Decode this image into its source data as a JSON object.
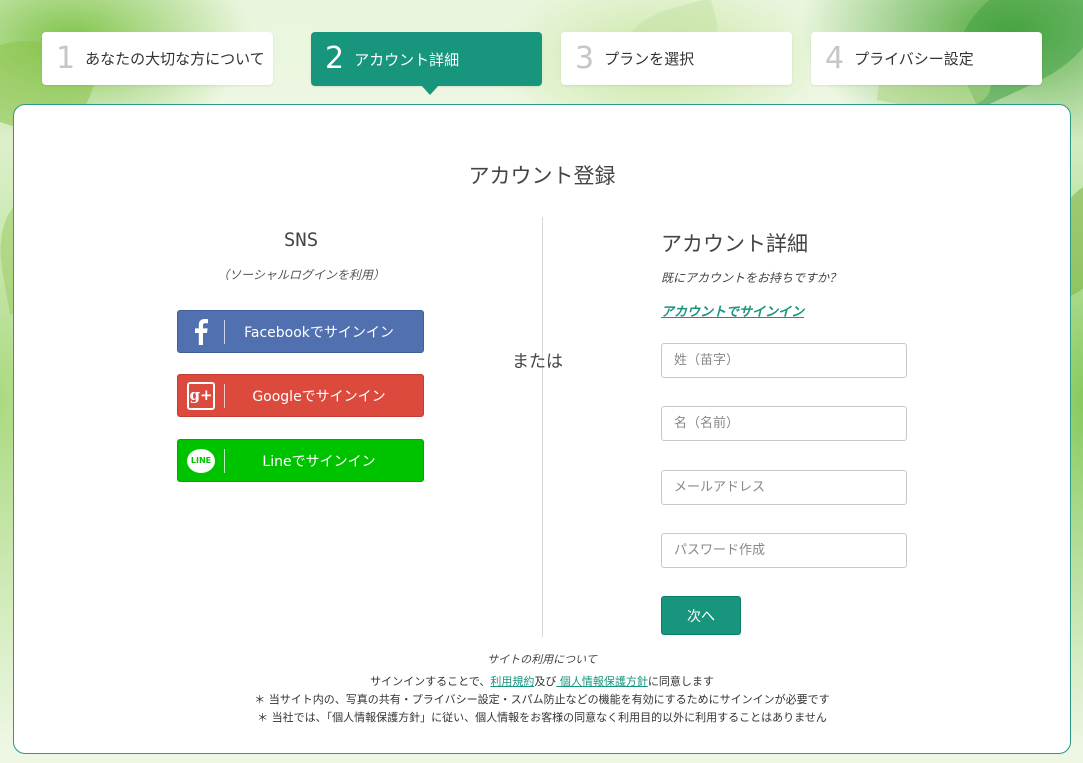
{
  "steps": [
    {
      "num": "1",
      "label": "あなたの大切な方について"
    },
    {
      "num": "2",
      "label": "アカウント詳細"
    },
    {
      "num": "3",
      "label": "プランを選択"
    },
    {
      "num": "4",
      "label": "プライバシー設定"
    }
  ],
  "card": {
    "title": "アカウント登録",
    "or_text": "または"
  },
  "sns": {
    "title": "SNS",
    "subtitle": "（ソーシャルログインを利用）",
    "facebook_label": "Facebookでサインイン",
    "google_label": "Googleでサインイン",
    "line_label": "Lineでサインイン",
    "google_icon_text": "g+",
    "line_icon_text": "LINE"
  },
  "account": {
    "title": "アカウント詳細",
    "question": "既にアカウントをお持ちですか？",
    "signin_link": "アカウントでサインイン",
    "last_name_placeholder": "姓（苗字）",
    "first_name_placeholder": "名（名前）",
    "email_placeholder": "メールアドレス",
    "password_placeholder": "パスワード作成",
    "next_label": "次へ"
  },
  "footer": {
    "title": "サイトの利用について",
    "agree_prefix": "サインインすることで、",
    "terms_link": "利用規約",
    "and_text": "及び",
    "privacy_link": " 個人情報保護方針",
    "agree_suffix": "に同意します",
    "note1": "＊ 当サイト内の、写真の共有・プライバシー設定・スパム防止などの機能を有効にするためにサインインが必要です",
    "note2": "＊ 当社では、「個人情報保護方針」に従い、個人情報をお客様の同意なく利用目的以外に利用することはありません"
  },
  "colors": {
    "accent": "#17957d",
    "facebook": "#5070b0",
    "google": "#dc4a3d",
    "line": "#00c300"
  }
}
